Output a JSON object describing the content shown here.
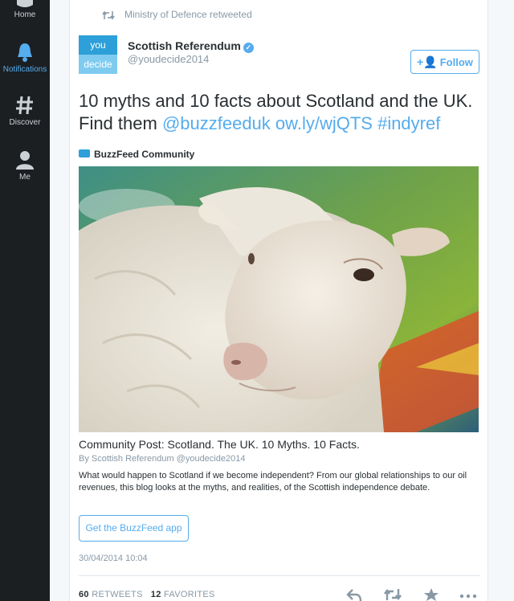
{
  "sidebar": {
    "items": [
      {
        "label": "Home",
        "icon": "home-icon"
      },
      {
        "label": "Notifications",
        "icon": "bell-icon",
        "active": true,
        "color": "#55acee"
      },
      {
        "label": "Discover",
        "icon": "hashtag-icon"
      },
      {
        "label": "Me",
        "icon": "person-icon"
      }
    ]
  },
  "tweet": {
    "retweeted_by": "Ministry of Defence retweeted",
    "avatar": {
      "top": "you",
      "bottom": "decide"
    },
    "display_name": "Scottish Referendum",
    "handle": "@youdecide2014",
    "follow_label": "Follow",
    "text_line1": "10 myths and 10 facts about Scotland and the UK.",
    "text_prefix": "Find them ",
    "mention": "@buzzfeeduk",
    "link": "ow.ly/wjQTS",
    "hashtag": "#indyref",
    "card": {
      "source": "BuzzFeed Community",
      "title": "Community Post: Scotland. The UK. 10 Myths. 10 Facts.",
      "byline": "By Scottish Referendum @youdecide2014",
      "summary": "What would happen to Scotland if we become independent? From our global relationships to our oil revenues, this blog looks at the myths, and realities, of the Scottish independence debate.",
      "app_button": "Get the BuzzFeed app"
    },
    "timestamp": "30/04/2014 10:04",
    "retweets_count": "60",
    "retweets_label": "RETWEETS",
    "favorites_count": "12",
    "favorites_label": "FAVORITES"
  },
  "colors": {
    "accent": "#55acee",
    "sidebar_bg": "#1c1f22",
    "text": "#292f33",
    "muted": "#8899a6"
  }
}
